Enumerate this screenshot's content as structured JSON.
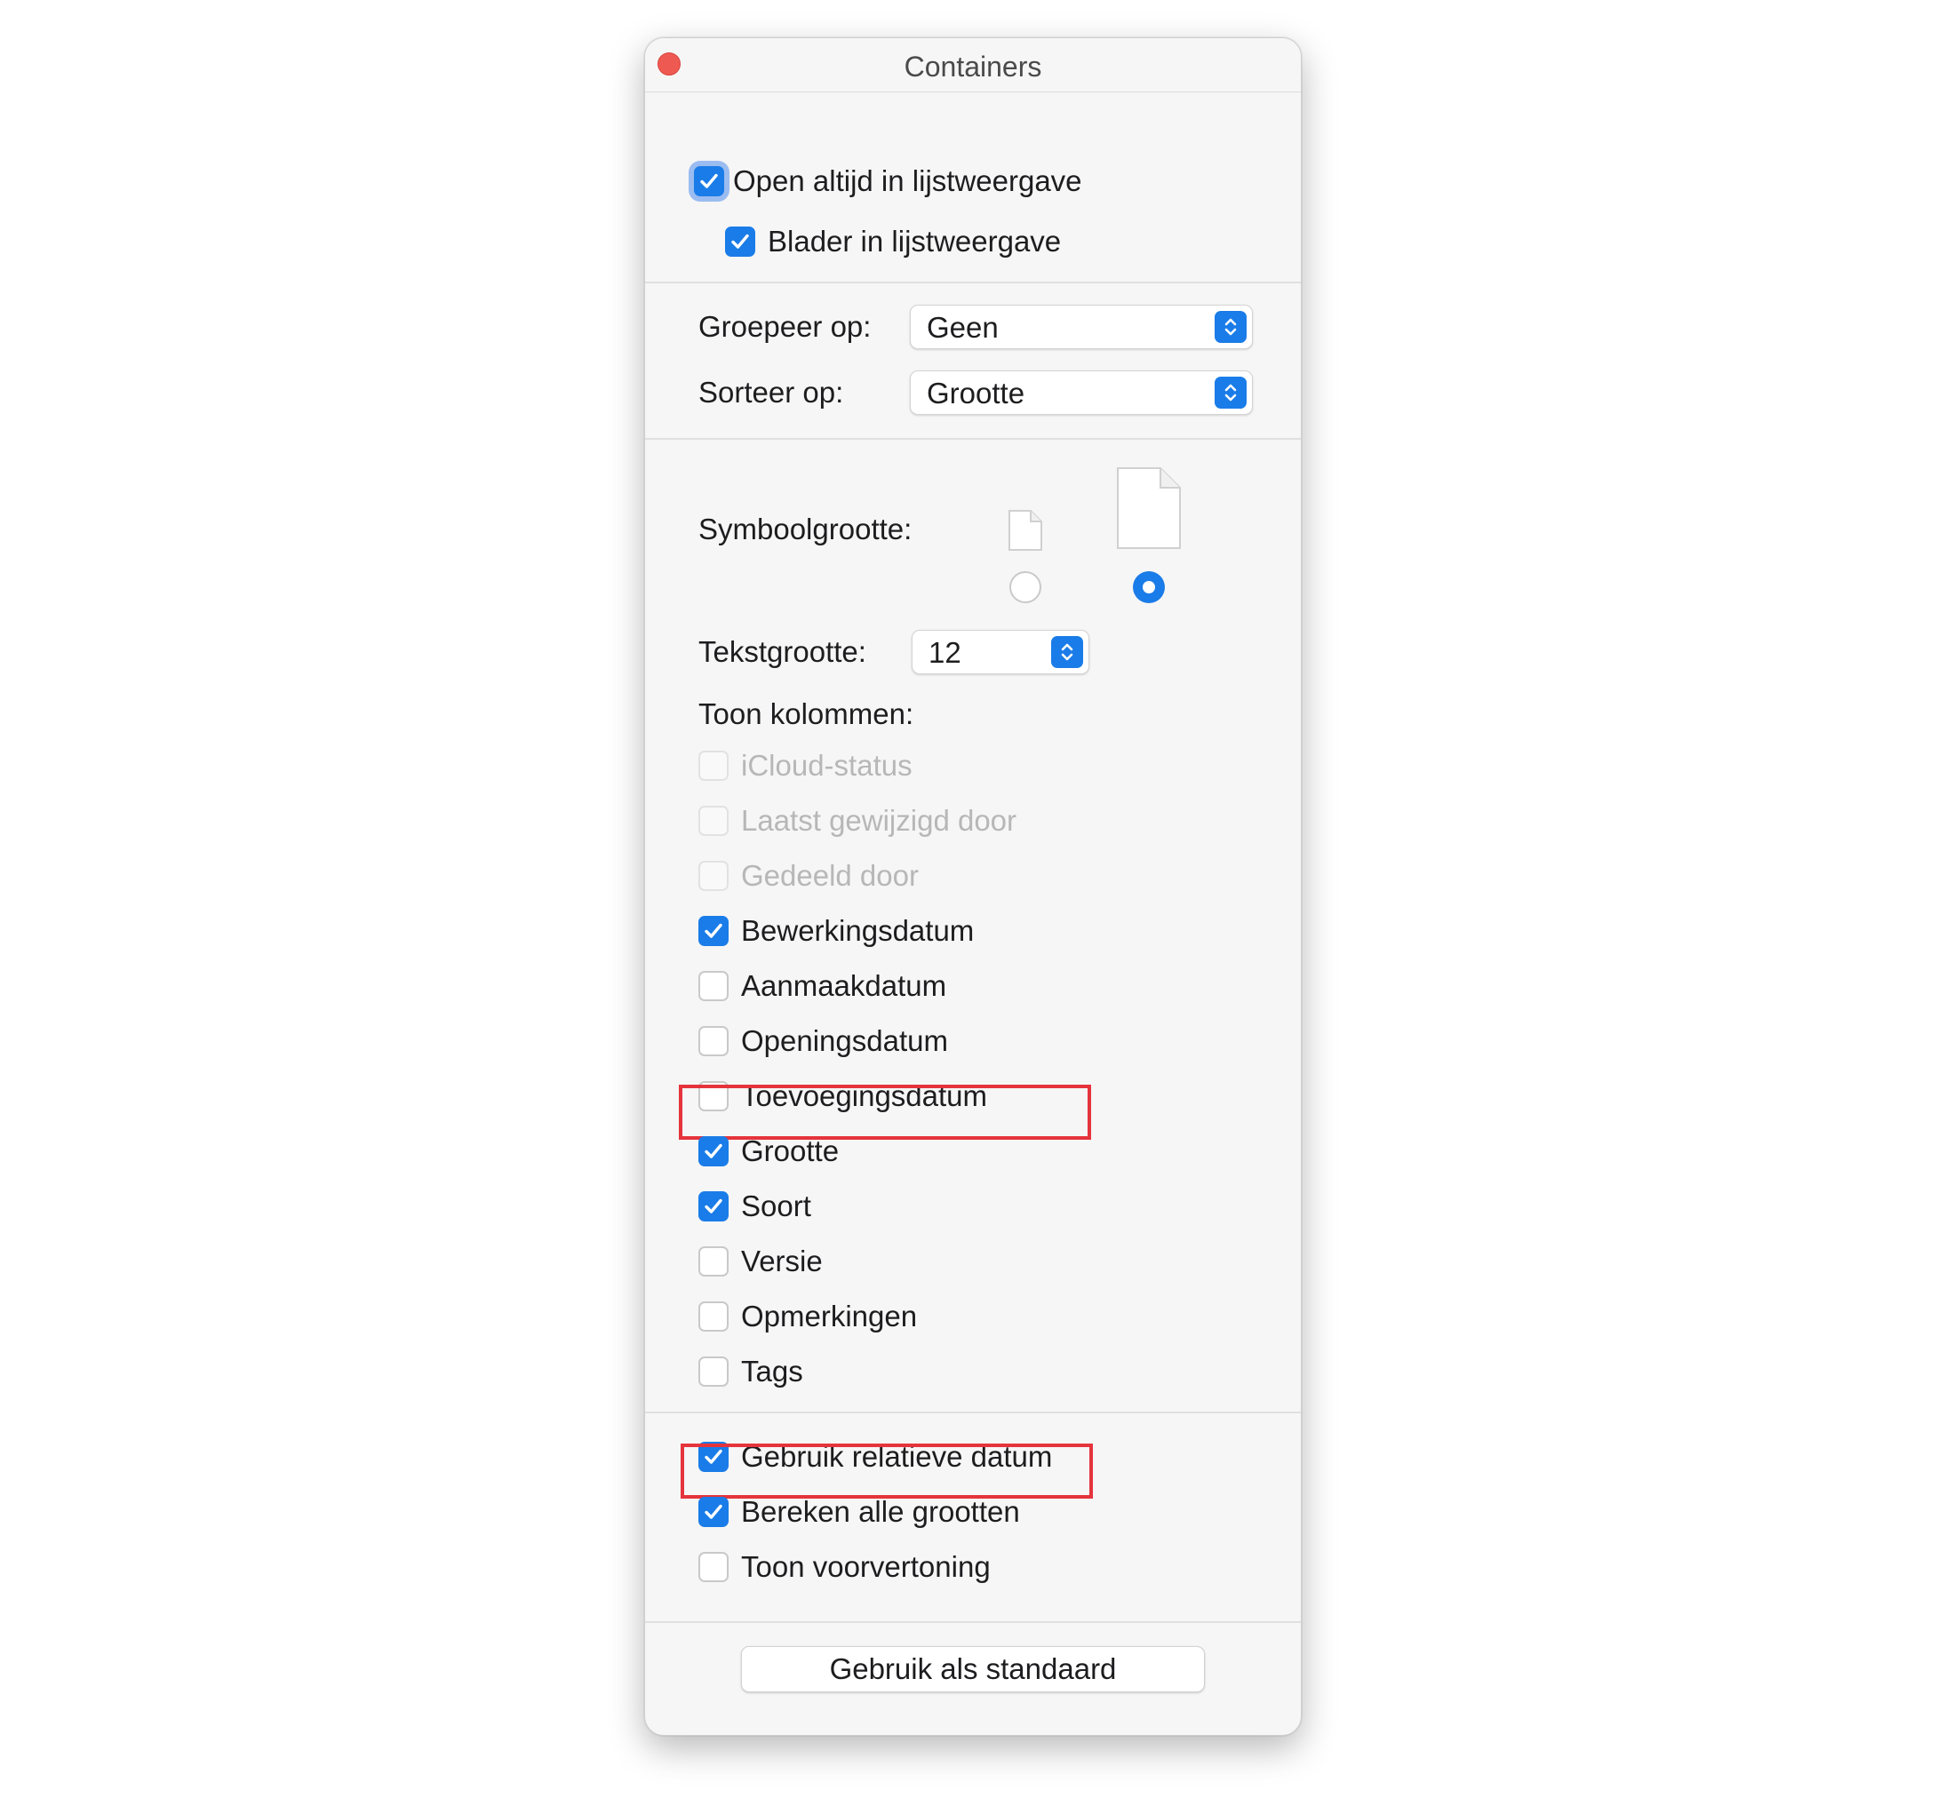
{
  "window": {
    "title": "Containers"
  },
  "top_options": [
    {
      "label": "Open altijd in lijstweergave",
      "checked": true,
      "focused": true
    },
    {
      "label": "Blader in lijstweergave",
      "checked": true
    }
  ],
  "group_by": {
    "label": "Groepeer op:",
    "value": "Geen"
  },
  "sort_by": {
    "label": "Sorteer op:",
    "value": "Grootte"
  },
  "icon_size": {
    "label": "Symboolgrootte:",
    "selected": "large",
    "options": [
      "small-document-icon",
      "large-document-icon"
    ]
  },
  "text_size": {
    "label": "Tekstgrootte:",
    "value": "12"
  },
  "columns": {
    "label": "Toon kolommen:",
    "items": [
      {
        "label": "iCloud-status",
        "checked": false,
        "enabled": false
      },
      {
        "label": "Laatst gewijzigd door",
        "checked": false,
        "enabled": false
      },
      {
        "label": "Gedeeld door",
        "checked": false,
        "enabled": false
      },
      {
        "label": "Bewerkingsdatum",
        "checked": true,
        "enabled": true
      },
      {
        "label": "Aanmaakdatum",
        "checked": false,
        "enabled": true
      },
      {
        "label": "Openingsdatum",
        "checked": false,
        "enabled": true
      },
      {
        "label": "Toevoegingsdatum",
        "checked": false,
        "enabled": true
      },
      {
        "label": "Grootte",
        "checked": true,
        "enabled": true,
        "highlighted": true
      },
      {
        "label": "Soort",
        "checked": true,
        "enabled": true
      },
      {
        "label": "Versie",
        "checked": false,
        "enabled": true
      },
      {
        "label": "Opmerkingen",
        "checked": false,
        "enabled": true
      },
      {
        "label": "Tags",
        "checked": false,
        "enabled": true
      }
    ]
  },
  "bottom_options": [
    {
      "label": "Gebruik relatieve datum",
      "checked": true
    },
    {
      "label": "Bereken alle grootten",
      "checked": true,
      "highlighted": true
    },
    {
      "label": "Toon voorvertoning",
      "checked": false
    }
  ],
  "default_button": {
    "label": "Gebruik als standaard"
  },
  "colors": {
    "accent": "#1a7ce8",
    "close": "#ee5a52",
    "highlight": "#e5343c",
    "panel": "#f6f6f6"
  }
}
